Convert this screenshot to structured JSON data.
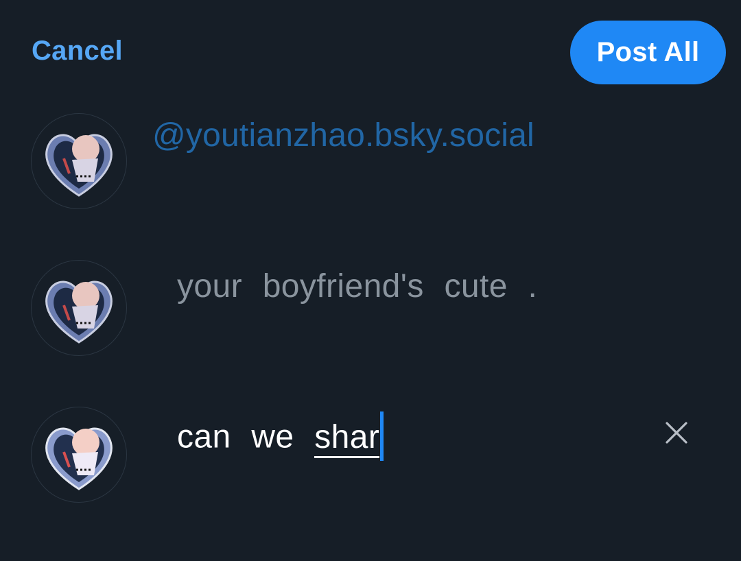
{
  "header": {
    "cancel_label": "Cancel",
    "post_all_label": "Post All"
  },
  "thread": {
    "posts": [
      {
        "text": "@youtianzhao.bsky.social",
        "state": "posted-handle"
      },
      {
        "text": "your boyfriend's cute .",
        "state": "placeholder"
      },
      {
        "text_committed": "can we ",
        "text_composing": "shar",
        "state": "editing"
      }
    ]
  },
  "icons": {
    "avatar": "heart-avatar-icon",
    "remove": "close-icon",
    "caret": "text-cursor"
  },
  "colors": {
    "background": "#161e27",
    "accent": "#1f88f5",
    "link": "#56a7f5",
    "handle": "#2166a5",
    "placeholder": "#8a949e",
    "text": "#ffffff"
  }
}
